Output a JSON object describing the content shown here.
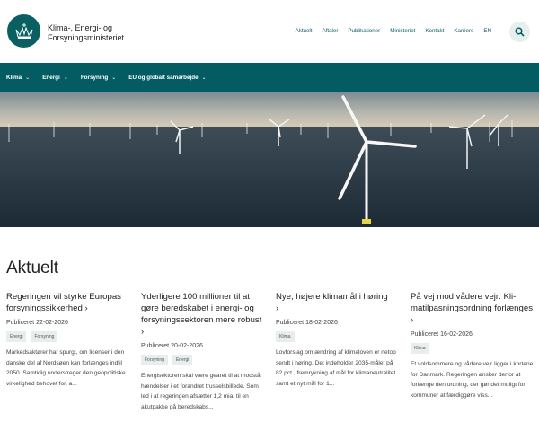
{
  "brand": {
    "line1": "Klima-, Energi- og",
    "line2": "Forsyningsministeriet"
  },
  "topnav": [
    "Aktuelt",
    "Aftaler",
    "Publikationer",
    "Ministeriet",
    "Kontakt",
    "Karriere",
    "EN"
  ],
  "mainnav": [
    "Klima",
    "Energi",
    "Forsyning",
    "EU og globalt samarbejde"
  ],
  "section_title": "Aktuelt",
  "cards": [
    {
      "title": "Regeringen vil styrke Europas forsyningssikkerhed",
      "date": "Publiceret 22-02-2026",
      "tags": [
        "Energi",
        "Forsyning"
      ],
      "text": "Markedsaktører har spurgt, om licenser i den danske del af Nordsøen kan forlænges indtil 2050. Samtidig understreger den geopolitiske virkelighed behovet for, a..."
    },
    {
      "title": "Yderligere 100 millioner til at gøre beredskabet i energi- og forsyningssektoren mere ro­bust",
      "date": "Publiceret 20-02-2026",
      "tags": [
        "Forsyning",
        "Energi"
      ],
      "text": "Energisektoren skal være gearet til at modstå hændelser i et forandret trusselsbillede. Som led i at regeringen afsætter 1,2 mia. til en akutpakke på beredskabs..."
    },
    {
      "title": "Nye, højere klimamål i høring",
      "date": "Publiceret 18-02-2026",
      "tags": [
        "Klima"
      ],
      "text": "Lovforslag om ændring af klimaloven er netop sendt i høring. Det indeholder 2035-målet på 82 pct., fremrykning af mål for klimaneutralitet samt et nyt mål for 1..."
    },
    {
      "title": "På vej mod vådere vejr: Kli­matilpasningsordning forlæn­ges",
      "date": "Publiceret 16-02-2026",
      "tags": [
        "Klima"
      ],
      "text": "Et voldsommere og vådere vejr ligger i kortene for Danmark. Regeringen ønsker derfor at forlænge den ordning, der gør det muligt for kommuner at færdiggøre viss..."
    }
  ]
}
